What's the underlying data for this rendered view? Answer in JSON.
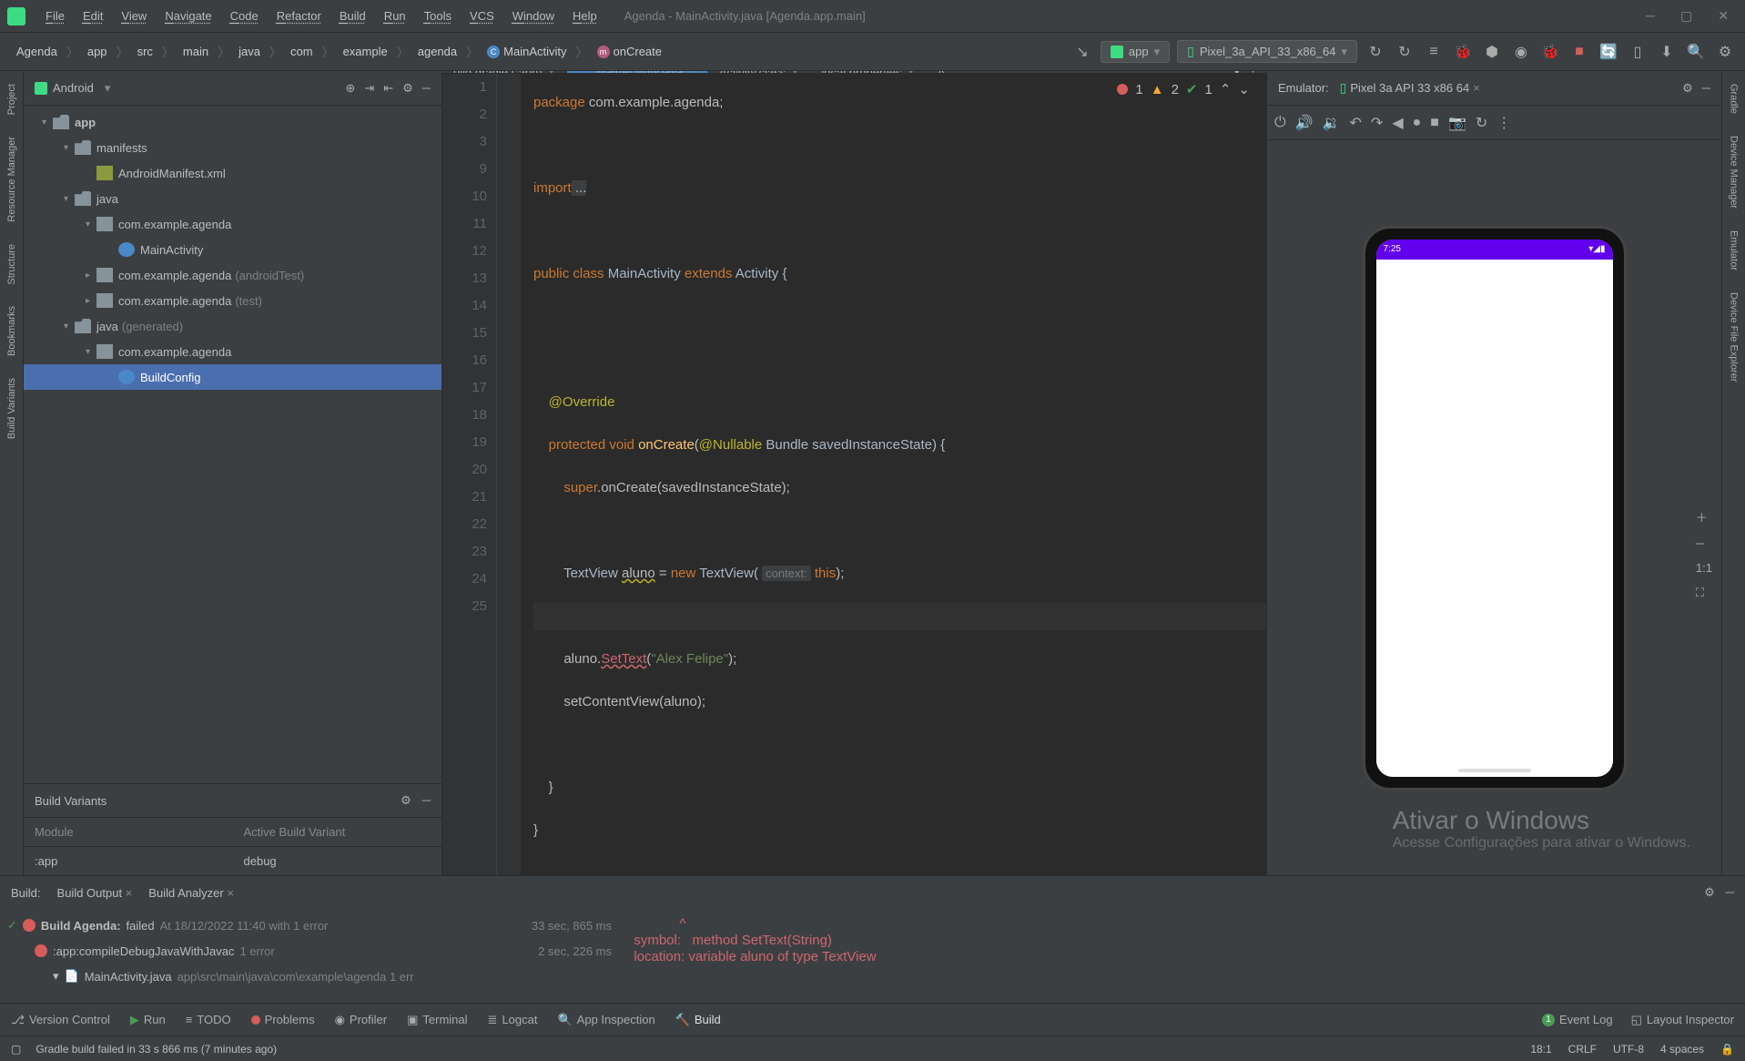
{
  "window": {
    "title": "Agenda - MainActivity.java [Agenda.app.main]"
  },
  "menubar": [
    "File",
    "Edit",
    "View",
    "Navigate",
    "Code",
    "Refactor",
    "Build",
    "Run",
    "Tools",
    "VCS",
    "Window",
    "Help"
  ],
  "breadcrumb": [
    "Agenda",
    "app",
    "src",
    "main",
    "java",
    "com",
    "example",
    "agenda",
    "MainActivity",
    "onCreate"
  ],
  "run_config": {
    "app": "app",
    "device": "Pixel_3a_API_33_x86_64"
  },
  "sidebar": {
    "mode": "Android",
    "tree": {
      "app": "app",
      "manifests": "manifests",
      "manifest_file": "AndroidManifest.xml",
      "java": "java",
      "pkg1": "com.example.agenda",
      "main_activity": "MainActivity",
      "pkg2": "com.example.agenda",
      "pkg2_suffix": "(androidTest)",
      "pkg3": "com.example.agenda",
      "pkg3_suffix": "(test)",
      "java_gen": "java",
      "java_gen_suffix": "(generated)",
      "pkg4": "com.example.agenda",
      "build_config": "BuildConfig"
    },
    "build_variants": {
      "title": "Build Variants",
      "col1": "Module",
      "col2": "Active Build Variant",
      "module": ":app",
      "variant": "debug"
    }
  },
  "tabs": {
    "t1": "uild.gradle (:app)",
    "t2": "MainActivity.java",
    "t3": "Activity.class",
    "t4": "local.properties",
    "t5": "A"
  },
  "inspections": {
    "errors": "1",
    "warnings": "2",
    "typos": "1"
  },
  "code": {
    "l1_a": "package",
    "l1_b": " com.example.agenda;",
    "l3_a": "import",
    "l3_b": " ...",
    "l10_a": "public class ",
    "l10_b": "MainActivity ",
    "l10_c": "extends ",
    "l10_d": "Activity {",
    "l13": "@Override",
    "l14_a": "protected void ",
    "l14_b": "onCreate",
    "l14_c": "(",
    "l14_d": "@Nullable ",
    "l14_e": "Bundle savedInstanceState) {",
    "l15_a": "super",
    "l15_b": ".onCreate(savedInstanceState);",
    "l17_a": "TextView ",
    "l17_b": "aluno",
    "l17_c": " = ",
    "l17_d": "new ",
    "l17_e": "TextView( ",
    "l17_hint": "context:",
    "l17_f": " this",
    "l17_g": ");",
    "l19_a": "aluno.",
    "l19_b": "SetText",
    "l19_c": "(",
    "l19_d": "\"Alex Felipe\"",
    "l19_e": ");",
    "l20": "setContentView(aluno);",
    "l22": "}",
    "l23": "}"
  },
  "emulator": {
    "label": "Emulator:",
    "device": "Pixel 3a API 33 x86 64",
    "status_time": "7:25"
  },
  "build": {
    "tab_label": "Build:",
    "tab1": "Build Output",
    "tab2": "Build Analyzer",
    "row1_a": "Build Agenda:",
    "row1_b": "failed",
    "row1_c": "At 18/12/2022 11:40 with 1 error",
    "row1_time": "33 sec, 865 ms",
    "row2_a": ":app:compileDebugJavaWithJavac",
    "row2_b": "1 error",
    "row2_time": "2 sec, 226 ms",
    "row3_a": "MainActivity.java",
    "row3_b": "app\\src\\main\\java\\com\\example\\agenda 1 err",
    "out_pointer": "^",
    "out1_a": "symbol:   ",
    "out1_b": "method SetText(String)",
    "out2_a": "location: ",
    "out2_b": "variable aluno of type TextView"
  },
  "watermark": {
    "line1": "Ativar o Windows",
    "line2": "Acesse Configurações para ativar o Windows."
  },
  "footer": {
    "version_control": "Version Control",
    "run": "Run",
    "todo": "TODO",
    "problems": "Problems",
    "profiler": "Profiler",
    "terminal": "Terminal",
    "logcat": "Logcat",
    "app_inspection": "App Inspection",
    "build": "Build",
    "event_log": "Event Log",
    "layout_inspector": "Layout Inspector"
  },
  "status": {
    "msg": "Gradle build failed in 33 s 866 ms (7 minutes ago)",
    "pos": "18:1",
    "le": "CRLF",
    "enc": "UTF-8",
    "indent": "4 spaces"
  },
  "left_rail": {
    "project": "Project",
    "resource_manager": "Resource Manager",
    "structure": "Structure",
    "bookmarks": "Bookmarks",
    "build_variants": "Build Variants"
  },
  "right_rail": {
    "gradle": "Gradle",
    "device_manager": "Device Manager",
    "emulator": "Emulator",
    "device_file": "Device File Explorer"
  }
}
